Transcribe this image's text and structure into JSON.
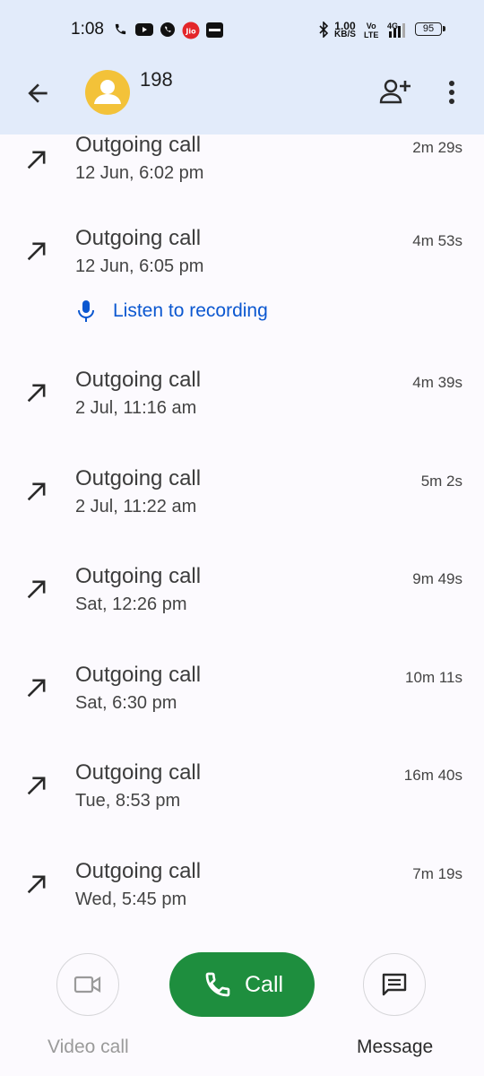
{
  "status_bar": {
    "time": "1:08",
    "net_speed_value": "1.00",
    "net_speed_unit": "KB/S",
    "volte_top": "Vo",
    "volte_bottom": "LTE",
    "network": "4G",
    "battery": "95",
    "icons": [
      "phone-icon",
      "youtube-icon",
      "whatsapp-icon",
      "jio-icon",
      "paytm-icon",
      "bluetooth-icon",
      "signal-icon",
      "battery-icon"
    ]
  },
  "header": {
    "contact_name": "198",
    "icons": [
      "back-arrow-icon",
      "avatar-person-icon",
      "add-contact-icon",
      "more-vert-icon"
    ]
  },
  "calls": [
    {
      "type": "Outgoing call",
      "time": "12 Jun, 6:02 pm",
      "duration": "2m 29s"
    },
    {
      "type": "Outgoing call",
      "time": "12 Jun, 6:05 pm",
      "duration": "4m 53s",
      "recording": "Listen to recording"
    },
    {
      "type": "Outgoing call",
      "time": "2 Jul, 11:16 am",
      "duration": "4m 39s"
    },
    {
      "type": "Outgoing call",
      "time": "2 Jul, 11:22 am",
      "duration": "5m 2s"
    },
    {
      "type": "Outgoing call",
      "time": "Sat, 12:26 pm",
      "duration": "9m 49s"
    },
    {
      "type": "Outgoing call",
      "time": "Sat, 6:30 pm",
      "duration": "10m 11s"
    },
    {
      "type": "Outgoing call",
      "time": "Tue, 8:53 pm",
      "duration": "16m 40s"
    },
    {
      "type": "Outgoing call",
      "time": "Wed, 5:45 pm",
      "duration": "7m 19s"
    }
  ],
  "actions": {
    "video_call": "Video call",
    "call": "Call",
    "message": "Message"
  },
  "colors": {
    "header_bg": "#e2ebfa",
    "page_bg": "#fcfafe",
    "avatar": "#f3c239",
    "call_button": "#1e8e3e",
    "link": "#0b57d0"
  }
}
